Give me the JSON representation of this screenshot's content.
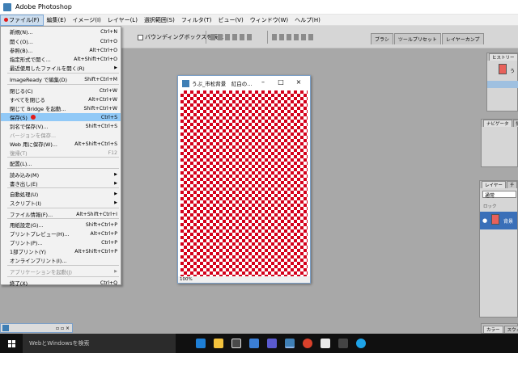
{
  "window": {
    "title": "Adobe Photoshop"
  },
  "menubar": [
    "ファイル(F)",
    "編集(E)",
    "イメージ(I)",
    "レイヤー(L)",
    "選択範囲(S)",
    "フィルタ(T)",
    "ビュー(V)",
    "ウィンドウ(W)",
    "ヘルプ(H)"
  ],
  "options": {
    "bbox_label": "バウンディングボックスを表示"
  },
  "palette_well": [
    "ブラシ",
    "ツールプリセット",
    "レイヤーカンプ"
  ],
  "file_menu": [
    {
      "label": "新規(N)...",
      "shortcut": "Ctrl+N"
    },
    {
      "label": "開く(O)...",
      "shortcut": "Ctrl+O"
    },
    {
      "label": "参照(B)...",
      "shortcut": "Alt+Ctrl+O"
    },
    {
      "label": "指定形式で開く...",
      "shortcut": "Alt+Shift+Ctrl+O"
    },
    {
      "label": "最近使用したファイルを開く(R)",
      "shortcut": "",
      "submenu": true
    },
    {
      "label": "ImageReady で編集(D)",
      "shortcut": "Shift+Ctrl+M"
    },
    {
      "label": "閉じる(C)",
      "shortcut": "Ctrl+W"
    },
    {
      "label": "すべてを閉じる",
      "shortcut": "Alt+Ctrl+W"
    },
    {
      "label": "閉じて Bridge を起動...",
      "shortcut": "Shift+Ctrl+W"
    },
    {
      "label": "保存(S)",
      "shortcut": "Ctrl+S",
      "highlight": true
    },
    {
      "label": "別名で保存(V)...",
      "shortcut": "Shift+Ctrl+S"
    },
    {
      "label": "バージョンを保存...",
      "shortcut": "",
      "disabled": true
    },
    {
      "label": "Web 用に保存(W)...",
      "shortcut": "Alt+Shift+Ctrl+S"
    },
    {
      "label": "復帰(T)",
      "shortcut": "F12",
      "disabled": true
    },
    {
      "label": "配置(L)...",
      "shortcut": ""
    },
    {
      "label": "読み込み(M)",
      "shortcut": "",
      "submenu": true
    },
    {
      "label": "書き出し(E)",
      "shortcut": "",
      "submenu": true
    },
    {
      "label": "自動処理(U)",
      "shortcut": "",
      "submenu": true
    },
    {
      "label": "スクリプト(I)",
      "shortcut": "",
      "submenu": true
    },
    {
      "label": "ファイル情報(F)...",
      "shortcut": "Alt+Shift+Ctrl+I"
    },
    {
      "label": "用紙設定(G)...",
      "shortcut": "Shift+Ctrl+P"
    },
    {
      "label": "プリントプレビュー(H)...",
      "shortcut": "Alt+Ctrl+P"
    },
    {
      "label": "プリント(P)...",
      "shortcut": "Ctrl+P"
    },
    {
      "label": "1部プリント(Y)",
      "shortcut": "Alt+Shift+Ctrl+P"
    },
    {
      "label": "オンラインプリント(I)...",
      "shortcut": ""
    },
    {
      "label": "アプリケーションを起動(J)",
      "shortcut": "",
      "disabled": true,
      "submenu": true
    },
    {
      "label": "終了(X)",
      "shortcut": "Ctrl+Q"
    }
  ],
  "document": {
    "title": "うぷ_市松背景　紅白の...",
    "zoom": "100%"
  },
  "panels": {
    "history_tab": "ヒストリー",
    "history_item": "う",
    "navigator_tab": "ナビゲータ",
    "info_tab": "情",
    "layers_tab": "レイヤー",
    "channels_tab": "チ",
    "blend_mode": "通常",
    "lock_label": "ロック",
    "layer_name": "背景",
    "color_tab": "カラー",
    "swatches_tab": "スウォッ"
  },
  "taskbar": {
    "search_placeholder": "WebとWindowsを検索"
  },
  "colors": {
    "checker_red": "#d4001a",
    "menu_highlight": "#91c9f7"
  }
}
